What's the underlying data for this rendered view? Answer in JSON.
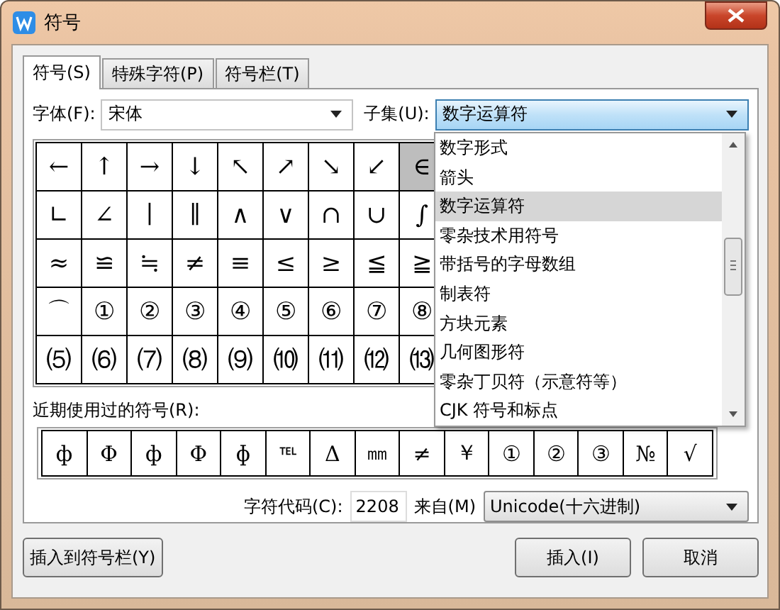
{
  "window": {
    "title": "符号"
  },
  "tabs": [
    {
      "label": "符号(S)",
      "selected": true
    },
    {
      "label": "特殊字符(P)",
      "selected": false
    },
    {
      "label": "符号栏(T)",
      "selected": false
    }
  ],
  "font_field": {
    "label": "字体(F):",
    "value": "宋体"
  },
  "subset_field": {
    "label": "子集(U):",
    "value": "数字运算符",
    "expanded": true
  },
  "subset_list": [
    {
      "label": "数字形式",
      "selected": false
    },
    {
      "label": "箭头",
      "selected": false
    },
    {
      "label": "数字运算符",
      "selected": true
    },
    {
      "label": "零杂技术用符号",
      "selected": false
    },
    {
      "label": "带括号的字母数组",
      "selected": false
    },
    {
      "label": "制表符",
      "selected": false
    },
    {
      "label": "方块元素",
      "selected": false
    },
    {
      "label": "几何图形符",
      "selected": false
    },
    {
      "label": "零杂丁贝符（示意符等）",
      "selected": false
    },
    {
      "label": "CJK 符号和标点",
      "selected": false
    }
  ],
  "symbol_grid": [
    [
      {
        "symbol": "←",
        "selected": false
      },
      {
        "symbol": "↑",
        "selected": false
      },
      {
        "symbol": "→",
        "selected": false
      },
      {
        "symbol": "↓",
        "selected": false
      },
      {
        "symbol": "↖",
        "selected": false
      },
      {
        "symbol": "↗",
        "selected": false
      },
      {
        "symbol": "↘",
        "selected": false
      },
      {
        "symbol": "↙",
        "selected": false
      },
      {
        "symbol": "∈",
        "selected": true
      }
    ],
    [
      {
        "symbol": "∟",
        "selected": false
      },
      {
        "symbol": "∠",
        "selected": false
      },
      {
        "symbol": "∣",
        "selected": false
      },
      {
        "symbol": "∥",
        "selected": false
      },
      {
        "symbol": "∧",
        "selected": false
      },
      {
        "symbol": "∨",
        "selected": false
      },
      {
        "symbol": "∩",
        "selected": false
      },
      {
        "symbol": "∪",
        "selected": false
      },
      {
        "symbol": "∫",
        "selected": false
      }
    ],
    [
      {
        "symbol": "≈",
        "selected": false
      },
      {
        "symbol": "≌",
        "selected": false
      },
      {
        "symbol": "≒",
        "selected": false
      },
      {
        "symbol": "≠",
        "selected": false
      },
      {
        "symbol": "≡",
        "selected": false
      },
      {
        "symbol": "≤",
        "selected": false
      },
      {
        "symbol": "≥",
        "selected": false
      },
      {
        "symbol": "≦",
        "selected": false
      },
      {
        "symbol": "≧",
        "selected": false
      }
    ],
    [
      {
        "symbol": "⌒",
        "selected": false
      },
      {
        "symbol": "①",
        "selected": false
      },
      {
        "symbol": "②",
        "selected": false
      },
      {
        "symbol": "③",
        "selected": false
      },
      {
        "symbol": "④",
        "selected": false
      },
      {
        "symbol": "⑤",
        "selected": false
      },
      {
        "symbol": "⑥",
        "selected": false
      },
      {
        "symbol": "⑦",
        "selected": false
      },
      {
        "symbol": "⑧",
        "selected": false
      }
    ],
    [
      {
        "symbol": "⑸",
        "selected": false
      },
      {
        "symbol": "⑹",
        "selected": false
      },
      {
        "symbol": "⑺",
        "selected": false
      },
      {
        "symbol": "⑻",
        "selected": false
      },
      {
        "symbol": "⑼",
        "selected": false
      },
      {
        "symbol": "⑽",
        "selected": false
      },
      {
        "symbol": "⑾",
        "selected": false
      },
      {
        "symbol": "⑿",
        "selected": false
      },
      {
        "symbol": "⒀",
        "selected": false
      }
    ]
  ],
  "recent": {
    "label": "近期使用过的符号(R):",
    "symbols": [
      "ф",
      "Φ",
      "ф",
      "Φ",
      "ɸ",
      "℡",
      "Δ",
      "㎜",
      "≠",
      "￥",
      "①",
      "②",
      "③",
      "№",
      "√"
    ]
  },
  "char_code": {
    "label": "字符代码(C):",
    "value": "2208"
  },
  "source": {
    "label": "来自(M)",
    "value": "Unicode(十六进制)"
  },
  "buttons": [
    {
      "label": "插入到符号栏(Y)"
    },
    {
      "label": "插入(I)"
    },
    {
      "label": "取消"
    }
  ]
}
